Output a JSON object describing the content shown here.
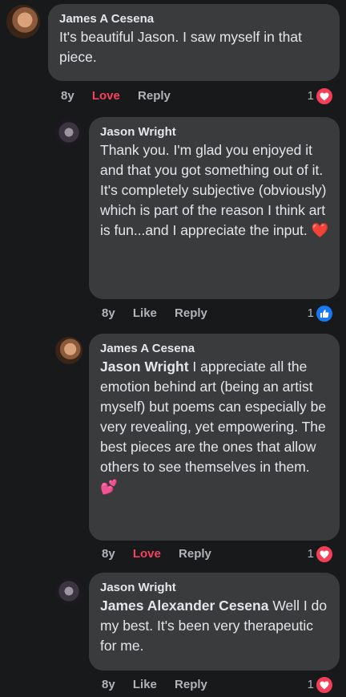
{
  "comments": [
    {
      "author": "James A Cesena",
      "text": "It's beautiful Jason. I saw myself in that piece.",
      "time": "8y",
      "action1": "Love",
      "action2": "Reply",
      "reaction_count": "1",
      "reaction_icon": "heart-icon"
    },
    {
      "author": "Jason Wright",
      "text": "Thank you. I'm glad you enjoyed it and that you got something out of it. It's completely subjective (obviously) which is part of the reason I think art is fun...and I appreciate the input.",
      "emoji": "❤️",
      "time": "8y",
      "action1": "Like",
      "action2": "Reply",
      "reaction_count": "1",
      "reaction_icon": "like-icon"
    },
    {
      "author": "James A Cesena",
      "mention": "Jason Wright",
      "text": " I appreciate all the emotion behind art (being an artist myself) but poems can especially be very revealing, yet empowering. The best pieces are the ones that allow others to see themselves in them.",
      "emoji": "💕",
      "time": "8y",
      "action1": "Love",
      "action2": "Reply",
      "reaction_count": "1",
      "reaction_icon": "heart-icon"
    },
    {
      "author": "Jason Wright",
      "mention": "James Alexander Cesena",
      "text": " Well I do my best. It's been very therapeutic for me.",
      "time": "8y",
      "action1": "Like",
      "action2": "Reply",
      "reaction_count": "1",
      "reaction_icon": "heart-icon"
    }
  ]
}
